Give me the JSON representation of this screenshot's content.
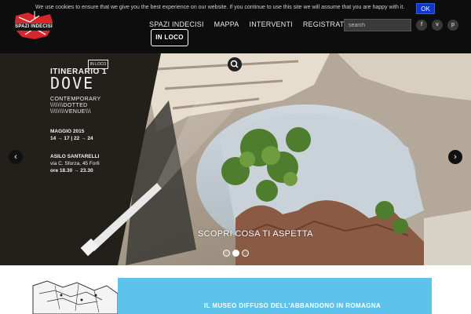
{
  "cookie": {
    "text": "We use cookies to ensure that we give you the best experience on our website. If you continue to use this site we will assume that you are happy with it.",
    "ok_label": "OK"
  },
  "brand": {
    "logo_text": "SPAZI INDECISI"
  },
  "nav": {
    "items": [
      {
        "label": "SPAZI INDECISI"
      },
      {
        "label": "MAPPA"
      },
      {
        "label": "INTERVENTI"
      },
      {
        "label": "REGISTRATI"
      }
    ]
  },
  "search": {
    "placeholder": "search",
    "value": ""
  },
  "social": [
    {
      "name": "facebook-icon",
      "glyph": "f"
    },
    {
      "name": "vimeo-icon",
      "glyph": "v"
    },
    {
      "name": "pinterest-icon",
      "glyph": "p"
    }
  ],
  "hero": {
    "poster": {
      "badge": "IN LOCO",
      "itinerary": "ITINERARIO 1",
      "title": "DOVE",
      "subtitle_1": "CONTEMPORARY",
      "subtitle_2": "\\\\\\\\\\\\\\DOTTED",
      "subtitle_3": "\\\\\\\\\\\\\\\\VENUE\\\\\\",
      "date_title": "MAGGIO 2015",
      "dates": "14 → 17 | 22 → 24",
      "venue": "ASILO SANTARELLI",
      "address": "via C. Sforza, 45 Forlì",
      "hours": "ore 18.30 → 23.30"
    },
    "caption": "SCOPRI COSA TI ASPETTA",
    "prev_glyph": "‹",
    "next_glyph": "›",
    "slides_active": 2
  },
  "banner": {
    "badge": "IN LOCO",
    "title": "IL MUSEO DIFFUSO DELL'ABBANDONO IN ROMAGNA"
  },
  "colors": {
    "header_bg": "#0d0d0d",
    "cookie_ok": "#1236c9",
    "banner_bg": "#5ec3ea",
    "logo_red": "#d7262e"
  }
}
